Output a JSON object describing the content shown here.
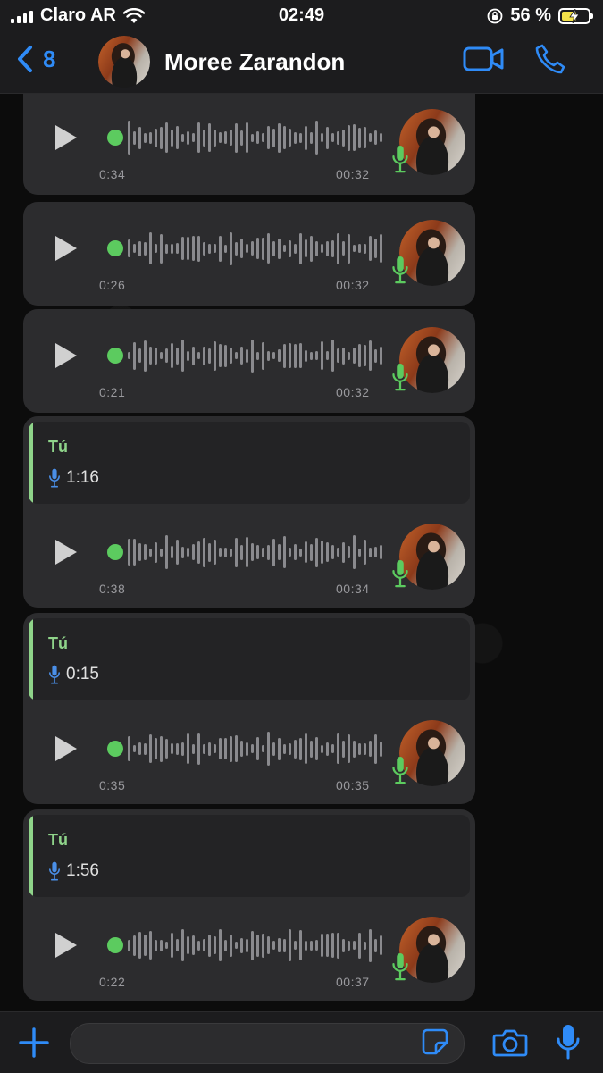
{
  "status_bar": {
    "carrier": "Claro AR",
    "time": "02:49",
    "battery_percent": "56 %",
    "battery_level": 0.56
  },
  "header": {
    "back_count": "8",
    "contact_name": "Moree Zarandon",
    "accent": "#2f8bf7"
  },
  "messages": [
    {
      "type": "voice",
      "elapsed": "0:34",
      "duration": "00:32"
    },
    {
      "type": "voice",
      "elapsed": "0:26",
      "duration": "00:32"
    },
    {
      "type": "voice",
      "elapsed": "0:21",
      "duration": "00:32"
    },
    {
      "type": "reply_voice",
      "quote_author": "Tú",
      "quote_duration": "1:16",
      "elapsed": "0:38",
      "duration": "00:34"
    },
    {
      "type": "reply_voice",
      "quote_author": "Tú",
      "quote_duration": "0:15",
      "elapsed": "0:35",
      "duration": "00:35"
    },
    {
      "type": "reply_voice",
      "quote_author": "Tú",
      "quote_duration": "1:56",
      "elapsed": "0:22",
      "duration": "00:37"
    }
  ],
  "colors": {
    "played_dot": "#5ccb5f",
    "quote_accent": "#8fd48a",
    "bubble": "#2c2c2e"
  },
  "icons": {
    "back": "chevron-left-icon",
    "video": "video-call-icon",
    "phone": "phone-icon",
    "play": "play-icon",
    "mic": "microphone-icon",
    "plus": "plus-icon",
    "sticker": "sticker-icon",
    "camera": "camera-icon"
  }
}
